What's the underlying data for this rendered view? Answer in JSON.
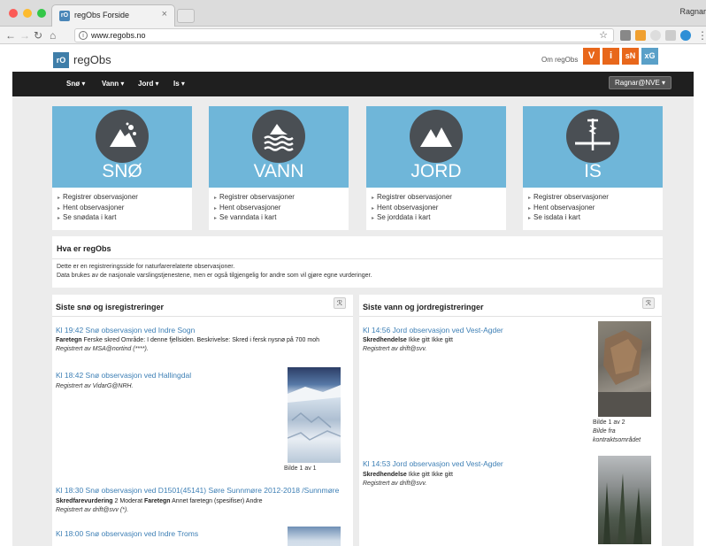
{
  "browser": {
    "tab_title": "regObs Forside",
    "tab_close": "×",
    "url": "www.regobs.no",
    "user_name": "Ragnar"
  },
  "site": {
    "logo_mark": "rO",
    "logo_text": "regObs",
    "about_link": "Om regObs",
    "badges": [
      {
        "label": "V",
        "color": "#e8671b"
      },
      {
        "label": "i",
        "color": "#e8671b"
      },
      {
        "label": "sN",
        "color": "#e8671b"
      },
      {
        "label": "xG",
        "color": "#5aa0c8"
      }
    ]
  },
  "nav": {
    "items": [
      "Snø ▾",
      "Vann ▾",
      "Jord ▾",
      "Is ▾"
    ],
    "user_menu": "Ragnar@NVE ▾"
  },
  "categories": [
    {
      "title": "SNØ",
      "icon": "avalanche-icon",
      "links": [
        "Registrer observasjoner",
        "Hent observasjoner",
        "Se snødata i kart"
      ]
    },
    {
      "title": "VANN",
      "icon": "water-icon",
      "links": [
        "Registrer observasjoner",
        "Hent observasjoner",
        "Se vanndata i kart"
      ]
    },
    {
      "title": "JORD",
      "icon": "mountain-icon",
      "links": [
        "Registrer observasjoner",
        "Hent observasjoner",
        "Se jorddata i kart"
      ]
    },
    {
      "title": "IS",
      "icon": "ice-drill-icon",
      "links": [
        "Registrer observasjoner",
        "Hent observasjoner",
        "Se isdata i kart"
      ]
    }
  ],
  "info": {
    "heading": "Hva er regObs",
    "line1": "Dette er en registreringsside for naturfarerelaterte observasjoner.",
    "line2": "Data brukes av de nasjonale varslingstjenestene, men er også tilgjengelig for andre som vil gjøre egne vurderinger."
  },
  "left_panel": {
    "heading": "Siste snø og isregistreringer",
    "entries": [
      {
        "title": "Kl 19:42 Snø observasjon ved Indre Sogn",
        "detail_label": "Faretegn",
        "detail_text": " Ferske skred Område: I denne fjellsiden. Beskrivelse: Skred i fersk nysnø på 700 moh",
        "registered": "Registrert av MSA@nortind (****)."
      },
      {
        "title": "Kl 18:42 Snø observasjon ved Hallingdal",
        "registered": "Registrert av VidarG@NRH.",
        "photo_caption": "Bilde 1 av 1"
      },
      {
        "title": "Kl 18:30 Snø observasjon ved D1501(45141) Søre Sunnmøre 2012-2018 /Sunnmøre",
        "detail_label": "Skredfarevurdering",
        "detail_text": " 2 Moderat ",
        "detail_label2": "Faretegn",
        "detail_text2": " Annet faretegn (spesifiser) Andre",
        "registered": "Registrert av drift@svv (*)."
      },
      {
        "title": "Kl 18:00 Snø observasjon ved Indre Troms"
      }
    ]
  },
  "right_panel": {
    "heading": "Siste vann og jordregistreringer",
    "entries": [
      {
        "title": "Kl 14:56 Jord observasjon ved Vest-Agder",
        "detail_label": "Skredhendelse",
        "detail_text": " Ikke gitt Ikke gitt",
        "registered": "Registrert av drift@svv.",
        "photo_caption": "Bilde 1 av 2",
        "photo_desc_1": "Bilde fra",
        "photo_desc_2": "kontraktsområdet"
      },
      {
        "title": "Kl 14:53 Jord observasjon ved Vest-Agder",
        "detail_label": "Skredhendelse",
        "detail_text": " Ikke gitt Ikke gitt",
        "registered": "Registrert av drift@svv."
      }
    ]
  }
}
